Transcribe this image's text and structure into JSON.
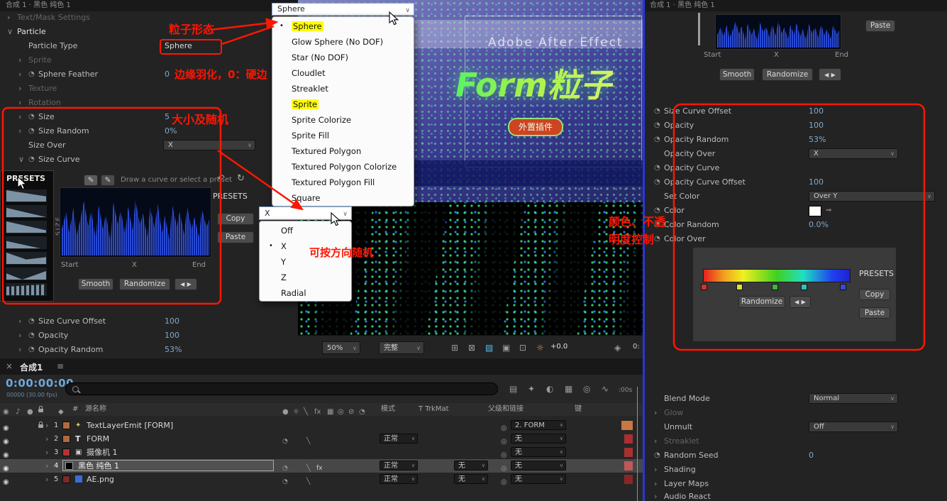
{
  "icons": {
    "collapsed": "›",
    "expanded": "∨",
    "stopwatch": "◔",
    "dropdown": "∨",
    "bullet": "•",
    "pencil": "✎",
    "undo": "↶",
    "redo": "↻",
    "prev": "◀",
    "next": "▶",
    "eye": "◉",
    "audio": "♪",
    "solo": "●",
    "close": "×",
    "menu": "≡",
    "pickwhip": "◎",
    "eyedropper": "⇒",
    "label_flag": "◆",
    "hash": "#",
    "text_layer": "T",
    "camera": "▣",
    "emitter": "✦",
    "sun": "☼",
    "quality_slash": "╲",
    "fx": "fx",
    "frame_blend": "▦",
    "motion_blur": "◎",
    "adjustment": "⊘",
    "dim_circle": "◔",
    "grid": "⊞",
    "mask": "⊠",
    "region": "▧",
    "guides": "▣",
    "rulers": "⊡",
    "gem": "◈",
    "flowchart": "▤",
    "draft": "✦",
    "shy": "◐",
    "wavetool": "∿"
  },
  "left_panel": {
    "tab": "合成 1 · 黑色 纯色 1",
    "rows": [
      {
        "label": "Text/Mask Settings"
      },
      {
        "label": "Particle"
      },
      {
        "label": "Particle Type",
        "value": "Sphere"
      },
      {
        "label": "Sprite"
      },
      {
        "label": "Sphere Feather",
        "value": "0"
      },
      {
        "label": "Texture"
      },
      {
        "label": "Rotation"
      },
      {
        "label": "Size",
        "value": "5"
      },
      {
        "label": "Size Random",
        "value": "0%"
      },
      {
        "label": "Size Over",
        "value": "X"
      },
      {
        "label": "Size Curve"
      }
    ],
    "curve": {
      "presets_title": "PRESETS",
      "hint": "Draw a curve or select a preset",
      "axis": "SIZE",
      "start": "Start",
      "mid": "X",
      "end": "End",
      "smooth": "Smooth",
      "randomize": "Randomize",
      "side_presets": "PRESETS",
      "copy": "Copy",
      "paste": "Paste"
    },
    "rows2": [
      {
        "label": "Size Curve Offset",
        "value": "100"
      },
      {
        "label": "Opacity",
        "value": "100"
      },
      {
        "label": "Opacity Random",
        "value": "53%"
      }
    ]
  },
  "particle_dropdown": {
    "selected": "Sphere",
    "items": [
      "Sphere",
      "Glow Sphere (No DOF)",
      "Star (No DOF)",
      "Cloudlet",
      "Streaklet",
      "Sprite",
      "Sprite Colorize",
      "Sprite Fill",
      "Textured Polygon",
      "Textured Polygon Colorize",
      "Textured Polygon Fill",
      "Square"
    ]
  },
  "direction_dropdown": {
    "selected": "X",
    "items": [
      "Off",
      "X",
      "Y",
      "Z",
      "Radial"
    ]
  },
  "viewer": {
    "watermark": "Adobe After Effect",
    "headline": "Form粒子",
    "badge": "外置插件",
    "zoom": "50%",
    "quality": "完整",
    "exposure": "+0.0",
    "time_fragment": "0:"
  },
  "timeline": {
    "tab": "合成1",
    "timecode": "0:00:00:00",
    "frame_info": "00000 (30.00 fps)",
    "ruler": ":00s",
    "name_header": "源名称",
    "mode_header": "模式",
    "trkmat_header": "T TrkMat",
    "parent_header": "父级和链接",
    "keys_header": "键",
    "layers": [
      {
        "num": "1",
        "name": "TextLayerEmit [FORM]",
        "mode": "",
        "trkmat": "",
        "parent": "2. FORM"
      },
      {
        "num": "2",
        "name": "FORM",
        "mode": "正常",
        "trkmat": "",
        "parent": "无"
      },
      {
        "num": "3",
        "name": "摄像机 1",
        "mode": "",
        "trkmat": "",
        "parent": "无"
      },
      {
        "num": "4",
        "name": "黑色 纯色 1",
        "mode": "正常",
        "trkmat": "无",
        "parent": "无"
      },
      {
        "num": "5",
        "name": "AE.png",
        "mode": "正常",
        "trkmat": "无",
        "parent": "无"
      }
    ]
  },
  "right_panel": {
    "tab": "合成 1 · 黑色 纯色 1",
    "paste": "Paste",
    "start": "Start",
    "mid": "X",
    "end": "End",
    "smooth": "Smooth",
    "randomize": "Randomize",
    "rows": [
      {
        "label": "Size Curve Offset",
        "value": "100"
      },
      {
        "label": "Opacity",
        "value": "100"
      },
      {
        "label": "Opacity Random",
        "value": "53%"
      },
      {
        "label": "Opacity Over",
        "value": "X"
      },
      {
        "label": "Opacity Curve",
        "value": ""
      },
      {
        "label": "Opacity Curve Offset",
        "value": "100"
      },
      {
        "label": "Set Color",
        "value": "Over Y"
      },
      {
        "label": "Color",
        "value": ""
      },
      {
        "label": "Color Random",
        "value": "0.0%"
      },
      {
        "label": "Color Over",
        "value": ""
      }
    ],
    "gradient": {
      "presets": "PRESETS",
      "randomize": "Randomize",
      "copy": "Copy",
      "paste": "Paste"
    },
    "rows2": [
      {
        "label": "Blend Mode",
        "value": "Normal"
      },
      {
        "label": "Glow",
        "value": ""
      },
      {
        "label": "Unmult",
        "value": "Off"
      },
      {
        "label": "Streaklet",
        "value": ""
      },
      {
        "label": "Random Seed",
        "value": "0"
      },
      {
        "label": "Shading",
        "value": ""
      },
      {
        "label": "Layer Maps",
        "value": ""
      },
      {
        "label": "Audio React",
        "value": ""
      }
    ]
  },
  "annotations": {
    "particle_shape": "粒子形态",
    "feather": "边缘羽化，0：硬边",
    "size_random": "大小及随机",
    "direction_random": "可按方向随机",
    "color_line1": "颜色、不透",
    "color_line2": "明度控制"
  }
}
